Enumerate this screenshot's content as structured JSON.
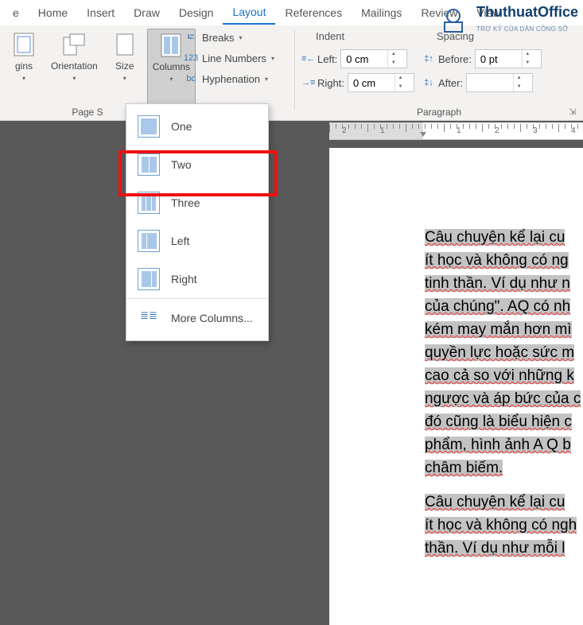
{
  "ribbon": {
    "tabs": [
      "e",
      "Home",
      "Insert",
      "Draw",
      "Design",
      "Layout",
      "References",
      "Mailings",
      "Review",
      "View"
    ],
    "active_tab": "Layout"
  },
  "page_setup": {
    "label": "Page S",
    "margins": "gins",
    "orientation": "Orientation",
    "size": "Size",
    "columns": "Columns",
    "breaks": "Breaks",
    "line_numbers": "Line Numbers",
    "hyphenation": "Hyphenation"
  },
  "paragraph": {
    "label": "Paragraph",
    "indent_hdr": "Indent",
    "spacing_hdr": "Spacing",
    "left_label": "Left:",
    "right_label": "Right:",
    "before_label": "Before:",
    "after_label": "After:",
    "left_val": "0 cm",
    "right_val": "0 cm",
    "before_val": "0 pt",
    "after_val": ""
  },
  "columns_menu": {
    "one": "One",
    "two": "Two",
    "three": "Three",
    "left": "Left",
    "right": "Right",
    "more": "More Columns..."
  },
  "ruler": {
    "nums": [
      "2",
      "1",
      "",
      "1",
      "2",
      "3",
      "4"
    ]
  },
  "doc": {
    "p1": [
      "Câu chuyện kể lại cu",
      "ít học và không có ng",
      "tinh thần. Ví dụ như n",
      "của chúng\". AQ có nh",
      "kém may mắn hơn mì",
      "quyền lực hoặc sức m",
      "cao cả so với những k",
      "ngược và áp bức của c",
      "đó cũng là biểu hiện c",
      "phẩm, hình ảnh A Q b",
      "châm biếm."
    ],
    "p2": [
      "Câu chuyện kể lại cu",
      "ít học và không có ngh",
      "thần. Ví dụ như mỗi l"
    ]
  },
  "watermark": {
    "main": "ThuthuatOffice",
    "sub": "TRỢ KỶ CỦA DÂN CÔNG SỞ"
  }
}
